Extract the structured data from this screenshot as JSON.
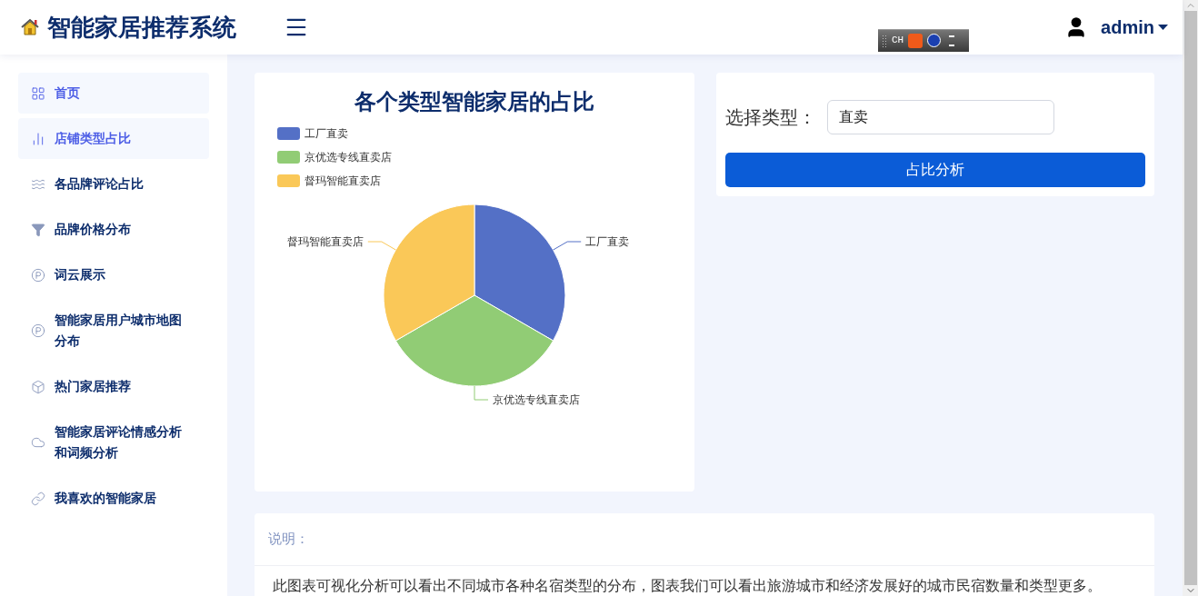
{
  "header": {
    "title": "智能家居推荐系统",
    "ime_toolbar": {
      "label": "CH"
    },
    "user": "admin"
  },
  "sidebar": {
    "items": [
      {
        "label": "首页",
        "selected": true
      },
      {
        "label": "店铺类型占比",
        "selected": true
      },
      {
        "label": "各品牌评论占比",
        "selected": false
      },
      {
        "label": "品牌价格分布",
        "selected": false
      },
      {
        "label": "词云展示",
        "selected": false
      },
      {
        "label": "智能家居用户城市地图分布",
        "selected": false
      },
      {
        "label": "热门家居推荐",
        "selected": false
      },
      {
        "label": "智能家居评论情感分析和词频分析",
        "selected": false
      },
      {
        "label": "我喜欢的智能家居",
        "selected": false
      }
    ]
  },
  "chart_card": {
    "title": "各个类型智能家居的占比",
    "slices": [
      {
        "legend": "工厂直卖",
        "label": "工厂直卖",
        "color": "#5470c6"
      },
      {
        "legend": "京优选专线直卖店",
        "label": "京优选专线直卖店",
        "color": "#91cc75"
      },
      {
        "legend": "督玛智能直卖店",
        "label": "督玛智能直卖店",
        "color": "#fac858"
      }
    ]
  },
  "form_card": {
    "label": "选择类型：",
    "value": "直卖",
    "button": "占比分析"
  },
  "note_card": {
    "heading": "说明：",
    "text": "此图表可视化分析可以看出不同城市各种名宿类型的分布，图表我们可以看出旅游城市和经济发展好的城市民宿数量和类型更多。"
  }
}
